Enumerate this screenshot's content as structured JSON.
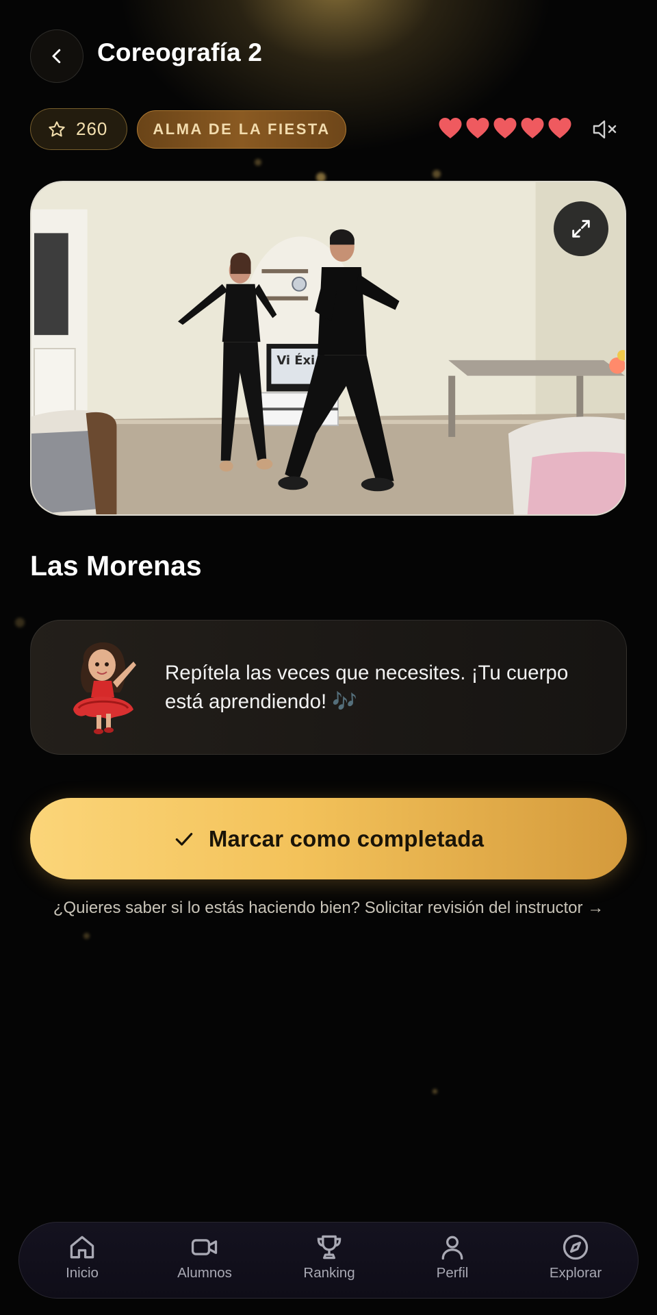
{
  "header": {
    "title": "Coreografía 2",
    "back_icon": "chevron-left-icon"
  },
  "status": {
    "points": "260",
    "rank_badge": "ALMA DE LA FIESTA",
    "lives": 5,
    "lives_total": 5,
    "sound": "muted"
  },
  "video": {
    "overlay_text": "Vi Éxi"
  },
  "song": {
    "title": "Las Morenas"
  },
  "tip": {
    "text": "Repítela las veces que necesites. ¡Tu cuerpo está aprendiendo! 🎶"
  },
  "cta": {
    "label": "Marcar como completada"
  },
  "review": {
    "text": "¿Quieres saber si lo estás haciendo bien? Solicitar revisión del instructor →"
  },
  "nav": {
    "items": [
      {
        "label": "Inicio",
        "icon": "home-icon"
      },
      {
        "label": "Alumnos",
        "icon": "video-camera-icon"
      },
      {
        "label": "Ranking",
        "icon": "trophy-icon"
      },
      {
        "label": "Perfil",
        "icon": "user-icon"
      },
      {
        "label": "Explorar",
        "icon": "compass-icon"
      }
    ]
  },
  "colors": {
    "accent_gold": "#f3c25a",
    "heart": "#ef5a5f",
    "badge_text": "#f2dcae"
  }
}
